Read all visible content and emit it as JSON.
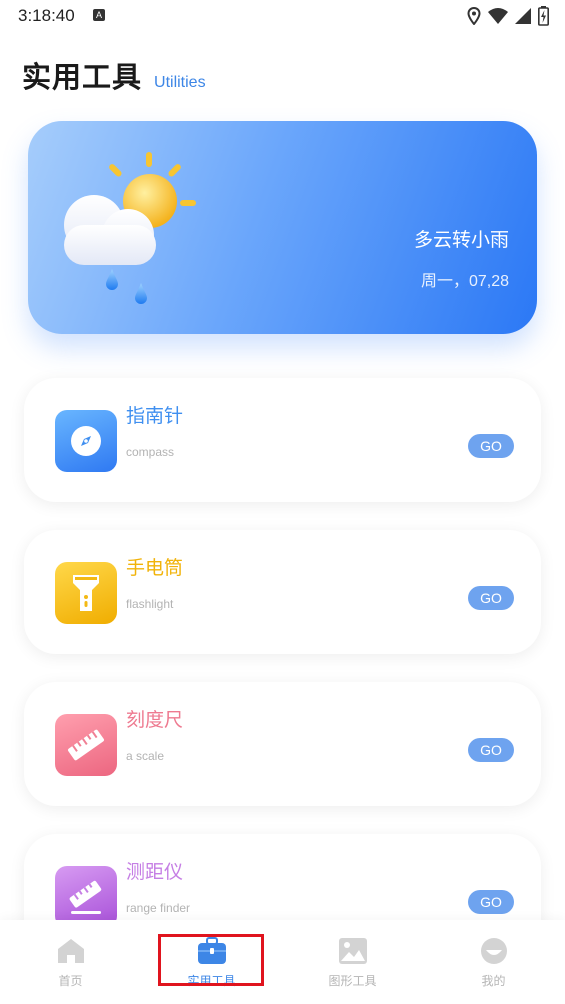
{
  "status_bar": {
    "time": "3:18:40",
    "notification_glyph": "A"
  },
  "header": {
    "title": "实用工具",
    "subtitle": "Utilities"
  },
  "weather": {
    "condition": "多云转小雨",
    "date": "周一，07,28",
    "icon": "partly-cloudy-rain-icon"
  },
  "tools": [
    {
      "name": "指南针",
      "subtitle": "compass",
      "go_label": "GO",
      "icon": "compass-icon",
      "color": "#3f8ff0"
    },
    {
      "name": "手电筒",
      "subtitle": "flashlight",
      "go_label": "GO",
      "icon": "flashlight-icon",
      "color": "#f3b914"
    },
    {
      "name": "刻度尺",
      "subtitle": "a scale",
      "go_label": "GO",
      "icon": "ruler-icon",
      "color": "#f07f94"
    },
    {
      "name": "测距仪",
      "subtitle": "range finder",
      "go_label": "GO",
      "icon": "range-finder-icon",
      "color": "#c57ee4"
    }
  ],
  "tab_bar": {
    "items": [
      {
        "label": "首页",
        "icon": "home-icon"
      },
      {
        "label": "实用工具",
        "icon": "toolbox-icon"
      },
      {
        "label": "图形工具",
        "icon": "image-icon"
      },
      {
        "label": "我的",
        "icon": "profile-icon"
      }
    ],
    "active_index": 1
  },
  "colors": {
    "accent": "#3d86e6",
    "go_button": "#6ea3ef",
    "highlight_box": "#e0141e"
  }
}
